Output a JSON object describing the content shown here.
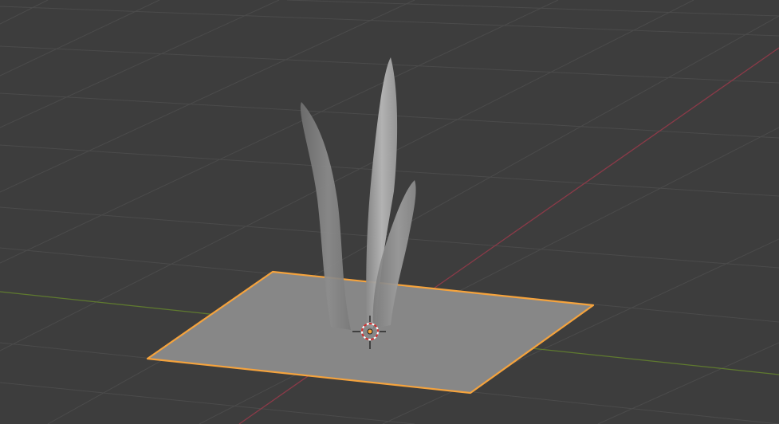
{
  "viewport": {
    "view": "3D Viewport",
    "shading": "solid",
    "objects": [
      {
        "name": "plane",
        "selected": true,
        "selection_color": "#f5a33d"
      },
      {
        "name": "grass-blades",
        "selected": false,
        "count": 3
      }
    ],
    "cursor": "3d-cursor-icon",
    "origin": "object-origin-icon"
  },
  "colors": {
    "background": "#3d3d3d",
    "grid": "#4b4b4b",
    "x_axis": "#8b3a48",
    "y_axis": "#5f7a2f",
    "plane_fill": "#878787",
    "plane_outline": "#f5a33d",
    "blade_fill": "#8e8e8e"
  }
}
